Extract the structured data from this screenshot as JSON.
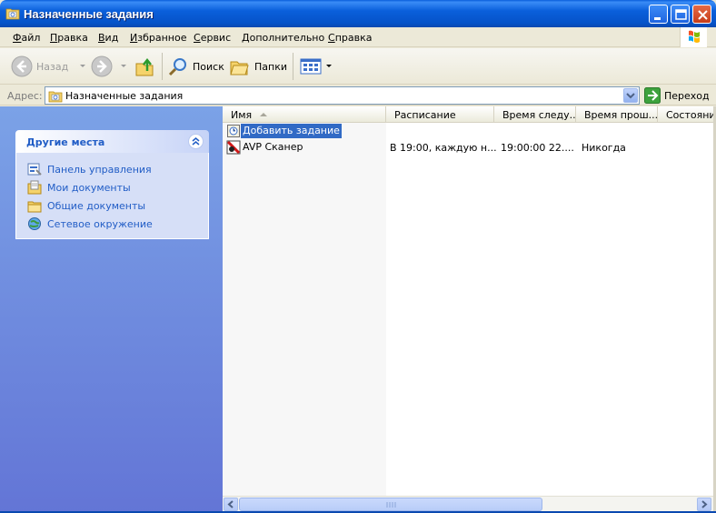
{
  "window": {
    "title": "Назначенные задания",
    "title_icon": "scheduled-tasks-folder-icon",
    "controls": [
      "minimize",
      "maximize",
      "close"
    ]
  },
  "menu": {
    "items": [
      {
        "label": "Файл",
        "accel": "Ф",
        "rest": "айл"
      },
      {
        "label": "Правка",
        "accel": "П",
        "rest": "равка"
      },
      {
        "label": "Вид",
        "accel": "В",
        "rest": "ид"
      },
      {
        "label": "Избранное",
        "accel": "И",
        "rest": "збранное"
      },
      {
        "label": "Сервис",
        "accel": "С",
        "rest": "ервис"
      },
      {
        "label": "Дополнительно",
        "accel": "Д",
        "rest": "ополнительно"
      },
      {
        "label": "Справка",
        "accel": "С",
        "rest": "правка"
      }
    ]
  },
  "toolbar": {
    "back_label": "Назад",
    "search_label": "Поиск",
    "folders_label": "Папки"
  },
  "address": {
    "label": "Адрес:",
    "value": "Назначенные задания",
    "go_label": "Переход"
  },
  "sidebar": {
    "panel_title": "Другие места",
    "items": [
      {
        "label": "Панель управления",
        "icon": "control-panel-icon"
      },
      {
        "label": "Мои документы",
        "icon": "my-documents-icon"
      },
      {
        "label": "Общие документы",
        "icon": "shared-documents-icon"
      },
      {
        "label": "Сетевое окружение",
        "icon": "network-places-icon"
      }
    ]
  },
  "list": {
    "columns": [
      "Имя",
      "Расписание",
      "Время следу...",
      "Время прош...",
      "Состояние"
    ],
    "sort_column": "Имя",
    "rows": [
      {
        "name": "Добавить задание",
        "icon": "add-task-icon",
        "schedule": "",
        "next_run": "",
        "last_run": "",
        "status": "",
        "selected": true
      },
      {
        "name": "AVP Сканер",
        "icon": "avp-scanner-task-icon",
        "schedule": "В 19:00, каждую н...",
        "next_run": "19:00:00  22....",
        "last_run": "Никогда",
        "status": "",
        "selected": false
      }
    ]
  },
  "colors": {
    "titlebar": "#0a5fdb",
    "sidebar_top": "#7ba2e7",
    "sidebar_bottom": "#6375d6",
    "link": "#215dc6",
    "selection": "#316ac5"
  }
}
